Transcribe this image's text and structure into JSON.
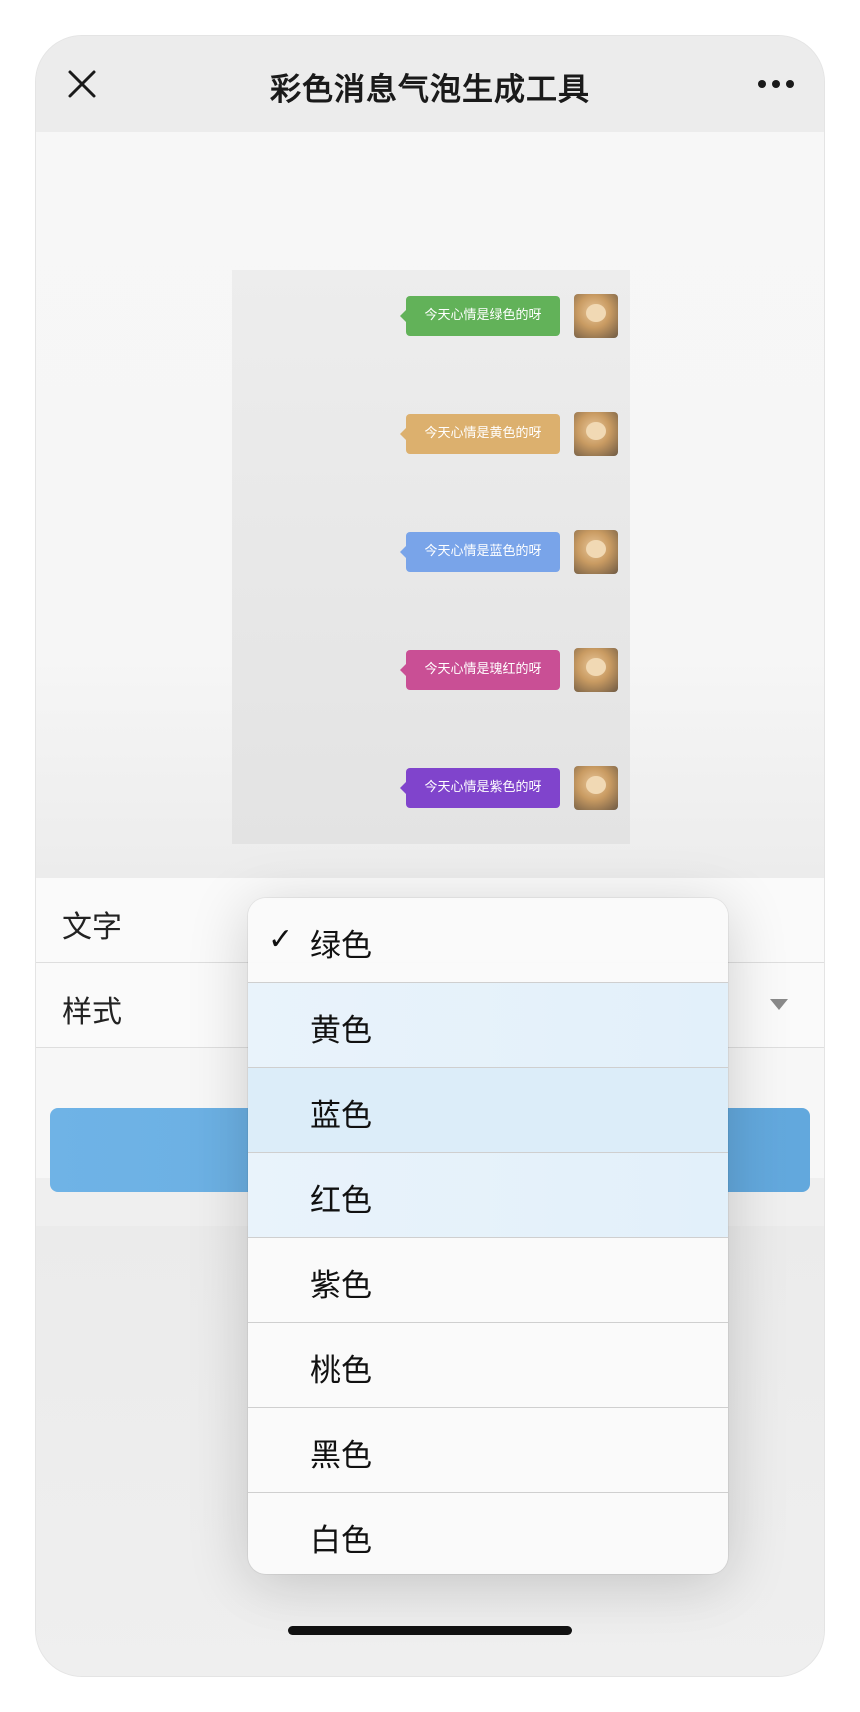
{
  "nav": {
    "title": "彩色消息气泡生成工具",
    "close_icon": "close-icon",
    "more_icon": "more-icon"
  },
  "preview": {
    "messages": [
      {
        "text": "今天心情是绿色的呀",
        "color": "#62b259"
      },
      {
        "text": "今天心情是黄色的呀",
        "color": "#dcb06e"
      },
      {
        "text": "今天心情是蓝色的呀",
        "color": "#79a4e9"
      },
      {
        "text": "今天心情是瑰红的呀",
        "color": "#c94f95"
      },
      {
        "text": "今天心情是紫色的呀",
        "color": "#8044cc"
      }
    ]
  },
  "form": {
    "text_label": "文字",
    "text_value": "",
    "style_label": "样式"
  },
  "picker": {
    "selected": "绿色",
    "options": [
      "绿色",
      "黄色",
      "蓝色",
      "红色",
      "紫色",
      "桃色",
      "黑色",
      "白色"
    ]
  },
  "colors": {
    "button": "#62a8dd",
    "background": "#efefef"
  }
}
